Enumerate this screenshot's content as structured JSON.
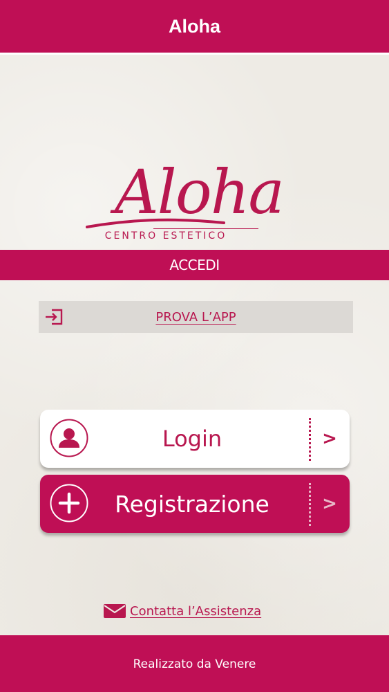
{
  "header": {
    "title": "Aloha"
  },
  "logo": {
    "wordmark": "Aloha",
    "subtitle": "CENTRO ESTETICO",
    "color": "#b8174f"
  },
  "accedi": {
    "label": "ACCEDI"
  },
  "prova": {
    "label": "PROVA L’APP",
    "icon": "sign-in-icon"
  },
  "buttons": {
    "login": {
      "label": "Login",
      "icon": "user-icon",
      "chevron": ">"
    },
    "register": {
      "label": "Registrazione",
      "icon": "plus-icon",
      "chevron": ">"
    }
  },
  "contact": {
    "label": "Contatta l’Assistenza",
    "icon": "mail-icon"
  },
  "footer": {
    "label": "Realizzato da Venere"
  },
  "colors": {
    "brand": "#bf0f55",
    "background": "#eeebe5",
    "prova_background": "#dcd9d5"
  }
}
